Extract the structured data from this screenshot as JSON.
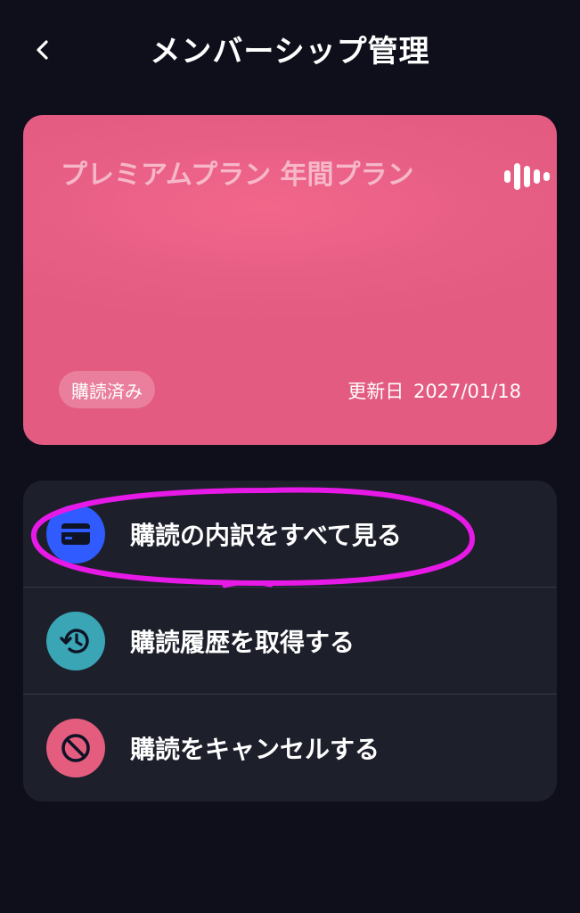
{
  "header": {
    "title": "メンバーシップ管理",
    "back_icon": "chevron-left-icon"
  },
  "card": {
    "plan_name": "プレミアムプラン 年間プラン",
    "status_badge": "購読済み",
    "renewal_label": "更新日",
    "renewal_date": "2027/01/18",
    "logo_icon": "soundwave-logo",
    "color": "#e85f86"
  },
  "menu": {
    "items": [
      {
        "label": "購読の内訳をすべて見る",
        "icon": "credit-card-icon",
        "icon_color": "#2f5bff"
      },
      {
        "label": "購読履歴を取得する",
        "icon": "history-icon",
        "icon_color": "#3aa5b4"
      },
      {
        "label": "購読をキャンセルする",
        "icon": "block-icon",
        "icon_color": "#e45d7f"
      }
    ]
  },
  "annotation": {
    "color": "#e619e6",
    "shape": "hand-drawn-ellipse",
    "target": "購読の内訳をすべて見る"
  }
}
